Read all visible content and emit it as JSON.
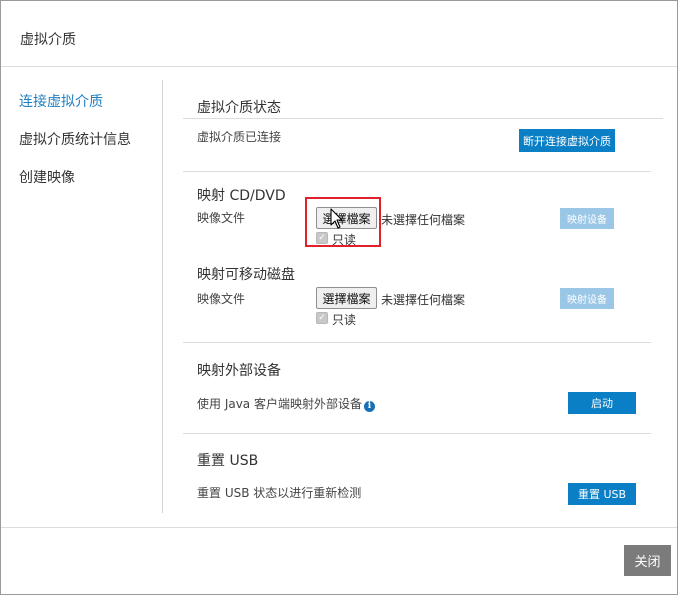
{
  "dialog": {
    "title": "虚拟介质",
    "close_label": "关闭"
  },
  "sidebar": {
    "items": [
      {
        "label": "连接虚拟介质",
        "active": true
      },
      {
        "label": "虚拟介质统计信息",
        "active": false
      },
      {
        "label": "创建映像",
        "active": false
      }
    ]
  },
  "status": {
    "title": "虚拟介质状态",
    "text": "虚拟介质已连接",
    "disconnect_label": "断开连接虚拟介质"
  },
  "cd": {
    "title": "映射 CD/DVD",
    "image_label": "映像文件",
    "choose_file_label": "選擇檔案",
    "no_file_text": "未選擇任何檔案",
    "readonly_label": "只读",
    "map_label": "映射设备"
  },
  "removable": {
    "title": "映射可移动磁盘",
    "image_label": "映像文件",
    "choose_file_label": "選擇檔案",
    "no_file_text": "未選擇任何檔案",
    "readonly_label": "只读",
    "map_label": "映射设备"
  },
  "external": {
    "title": "映射外部设备",
    "text": "使用 Java 客户端映射外部设备",
    "start_label": "启动"
  },
  "usb": {
    "title": "重置 USB",
    "text": "重置 USB 状态以进行重新检测",
    "reset_label": "重置 USB"
  },
  "colors": {
    "accent": "#0b7fc6",
    "accent_disabled": "#9bc7e6",
    "highlight": "#e0202a",
    "close_button": "#7b7b7b",
    "active_nav": "#1f7fc1"
  }
}
